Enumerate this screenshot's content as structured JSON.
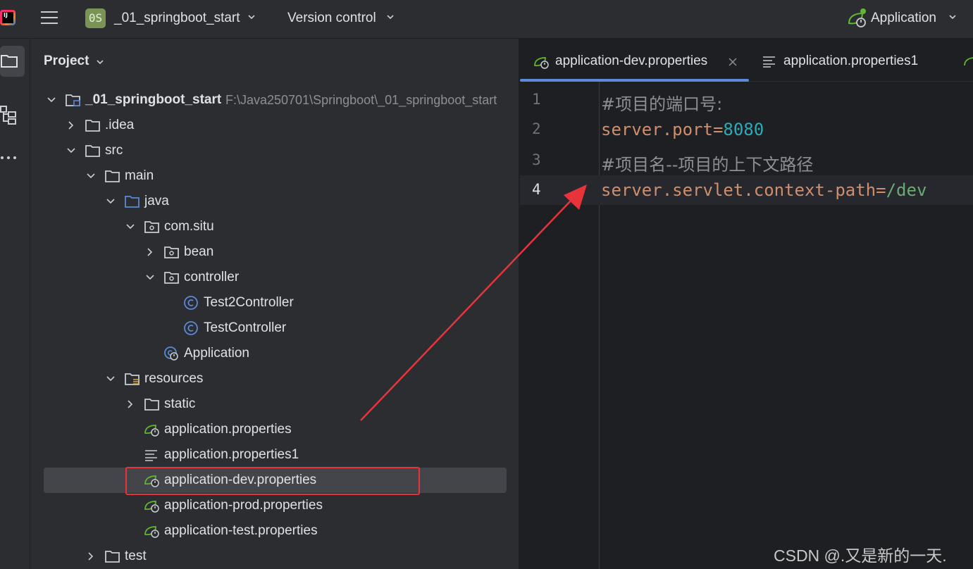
{
  "topbar": {
    "project_badge": "0S",
    "project_name": "_01_springboot_start",
    "version_control": "Version control",
    "run_config": "Application"
  },
  "project_panel": {
    "title": "Project",
    "tree": [
      {
        "label": "_01_springboot_start",
        "path": "F:\\Java250701\\Springboot\\_01_springboot_start",
        "icon": "module-folder-icon",
        "expanded": true
      },
      {
        "label": ".idea",
        "icon": "folder-icon",
        "expanded": false
      },
      {
        "label": "src",
        "icon": "folder-icon",
        "expanded": true
      },
      {
        "label": "main",
        "icon": "folder-icon",
        "expanded": true
      },
      {
        "label": "java",
        "icon": "source-folder-icon",
        "expanded": true
      },
      {
        "label": "com.situ",
        "icon": "package-icon",
        "expanded": true
      },
      {
        "label": "bean",
        "icon": "package-icon",
        "expanded": false
      },
      {
        "label": "controller",
        "icon": "package-icon",
        "expanded": true
      },
      {
        "label": "Test2Controller",
        "icon": "class-icon"
      },
      {
        "label": "TestController",
        "icon": "class-icon"
      },
      {
        "label": "Application",
        "icon": "spring-boot-app-icon"
      },
      {
        "label": "resources",
        "icon": "resources-folder-icon",
        "expanded": true
      },
      {
        "label": "static",
        "icon": "folder-icon",
        "expanded": false
      },
      {
        "label": "application.properties",
        "icon": "spring-properties-icon"
      },
      {
        "label": "application.properties1",
        "icon": "text-file-icon"
      },
      {
        "label": "application-dev.properties",
        "icon": "spring-properties-icon",
        "selected": true
      },
      {
        "label": "application-prod.properties",
        "icon": "spring-properties-icon"
      },
      {
        "label": "application-test.properties",
        "icon": "spring-properties-icon"
      },
      {
        "label": "test",
        "icon": "folder-icon",
        "expanded": false
      }
    ]
  },
  "editor": {
    "tabs": [
      {
        "label": "application-dev.properties",
        "active": true,
        "icon": "spring-properties-icon"
      },
      {
        "label": "application.properties1",
        "active": false,
        "icon": "text-file-icon"
      }
    ],
    "lines": [
      {
        "num": "1",
        "comment": "#项目的端口号:"
      },
      {
        "num": "2",
        "key": "server.port",
        "eq": "=",
        "value": "8080"
      },
      {
        "num": "3",
        "comment": "#项目名--项目的上下文路径"
      },
      {
        "num": "4",
        "key": "server.servlet.context-path",
        "eq": "=",
        "value": "/dev"
      }
    ]
  },
  "watermark": "CSDN @.又是新的一天."
}
